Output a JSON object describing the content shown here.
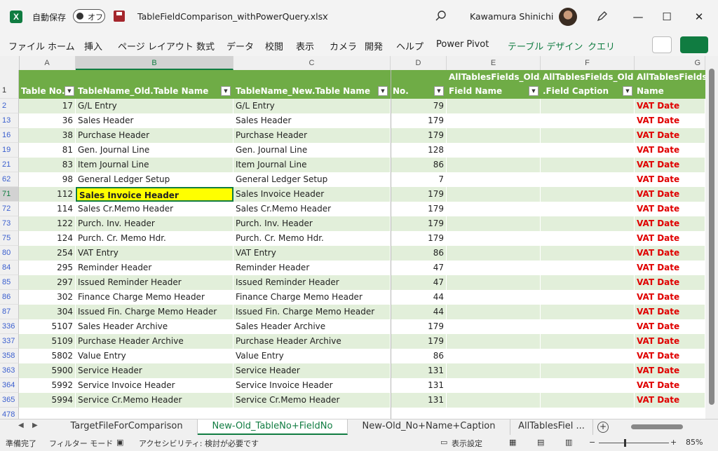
{
  "titlebar": {
    "app_icon": "excel-icon",
    "autosave_label": "自動保存",
    "autosave_state": "オフ",
    "file_name": "TableFieldComparison_withPowerQuery.xlsx",
    "user_name": "Kawamura Shinichi"
  },
  "menu": [
    "ファイル",
    "ホーム",
    "挿入",
    "ページ レイアウト",
    "数式",
    "データ",
    "校閲",
    "表示",
    "カメラ",
    "開発",
    "ヘルプ",
    "Power Pivot",
    "テーブル デザイン",
    "クエリ"
  ],
  "columns": [
    "A",
    "B",
    "C",
    "D",
    "E",
    "F",
    "G"
  ],
  "header_row_num": "1",
  "headers": {
    "a": "Table No.",
    "b": "TableName_Old.Table Name",
    "c": "TableName_New.Table Name",
    "d": "No.",
    "e1": "AllTablesFields_Old.",
    "e2": "Field Name",
    "f1": "AllTablesFields_Old",
    "f2": ".Field Caption",
    "g1": "AllTablesFields",
    "g2": "Name"
  },
  "rows": [
    {
      "r": "2",
      "a": "17",
      "b": "G/L Entry",
      "c": "G/L Entry",
      "d": "79",
      "g": "VAT Date"
    },
    {
      "r": "13",
      "a": "36",
      "b": "Sales Header",
      "c": "Sales Header",
      "d": "179",
      "g": "VAT Date"
    },
    {
      "r": "16",
      "a": "38",
      "b": "Purchase Header",
      "c": "Purchase Header",
      "d": "179",
      "g": "VAT Date"
    },
    {
      "r": "19",
      "a": "81",
      "b": "Gen. Journal Line",
      "c": "Gen. Journal Line",
      "d": "128",
      "g": "VAT Date"
    },
    {
      "r": "21",
      "a": "83",
      "b": "Item Journal Line",
      "c": "Item Journal Line",
      "d": "86",
      "g": "VAT Date"
    },
    {
      "r": "62",
      "a": "98",
      "b": "General Ledger Setup",
      "c": "General Ledger Setup",
      "d": "7",
      "g": "VAT Date"
    },
    {
      "r": "71",
      "a": "112",
      "b": "Sales Invoice Header",
      "c": "Sales Invoice Header",
      "d": "179",
      "g": "VAT Date"
    },
    {
      "r": "72",
      "a": "114",
      "b": "Sales Cr.Memo Header",
      "c": "Sales Cr.Memo Header",
      "d": "179",
      "g": "VAT Date"
    },
    {
      "r": "73",
      "a": "122",
      "b": "Purch. Inv. Header",
      "c": "Purch. Inv. Header",
      "d": "179",
      "g": "VAT Date"
    },
    {
      "r": "75",
      "a": "124",
      "b": "Purch. Cr. Memo Hdr.",
      "c": "Purch. Cr. Memo Hdr.",
      "d": "179",
      "g": "VAT Date"
    },
    {
      "r": "80",
      "a": "254",
      "b": "VAT Entry",
      "c": "VAT Entry",
      "d": "86",
      "g": "VAT Date"
    },
    {
      "r": "84",
      "a": "295",
      "b": "Reminder Header",
      "c": "Reminder Header",
      "d": "47",
      "g": "VAT Date"
    },
    {
      "r": "85",
      "a": "297",
      "b": "Issued Reminder Header",
      "c": "Issued Reminder Header",
      "d": "47",
      "g": "VAT Date"
    },
    {
      "r": "86",
      "a": "302",
      "b": "Finance Charge Memo Header",
      "c": "Finance Charge Memo Header",
      "d": "44",
      "g": "VAT Date"
    },
    {
      "r": "87",
      "a": "304",
      "b": "Issued Fin. Charge Memo Header",
      "c": "Issued Fin. Charge Memo Header",
      "d": "44",
      "g": "VAT Date"
    },
    {
      "r": "336",
      "a": "5107",
      "b": "Sales Header Archive",
      "c": "Sales Header Archive",
      "d": "179",
      "g": "VAT Date"
    },
    {
      "r": "337",
      "a": "5109",
      "b": "Purchase Header Archive",
      "c": "Purchase Header Archive",
      "d": "179",
      "g": "VAT Date"
    },
    {
      "r": "358",
      "a": "5802",
      "b": "Value Entry",
      "c": "Value Entry",
      "d": "86",
      "g": "VAT Date"
    },
    {
      "r": "363",
      "a": "5900",
      "b": "Service Header",
      "c": "Service Header",
      "d": "131",
      "g": "VAT Date"
    },
    {
      "r": "364",
      "a": "5992",
      "b": "Service Invoice Header",
      "c": "Service Invoice Header",
      "d": "131",
      "g": "VAT Date"
    },
    {
      "r": "365",
      "a": "5994",
      "b": "Service Cr.Memo Header",
      "c": "Service Cr.Memo Header",
      "d": "131",
      "g": "VAT Date"
    }
  ],
  "last_row_num": "478",
  "selected_cell": {
    "row": "71",
    "col": "B"
  },
  "sheet_tabs": [
    "TargetFileForComparison",
    "New-Old_TableNo+FieldNo",
    "New-Old_No+Name+Caption",
    "AllTablesFiel ..."
  ],
  "active_tab": 1,
  "status": {
    "ready": "準備完了",
    "filter_mode": "フィルター モード",
    "accessibility": "アクセシビリティ: 検討が必要です",
    "display_settings": "表示設定",
    "zoom": "85%"
  },
  "colors": {
    "table_header": "#6fac46",
    "band": "#e2efda",
    "vat": "#e00000",
    "accent": "#107c41",
    "highlight": "#ffff00"
  }
}
